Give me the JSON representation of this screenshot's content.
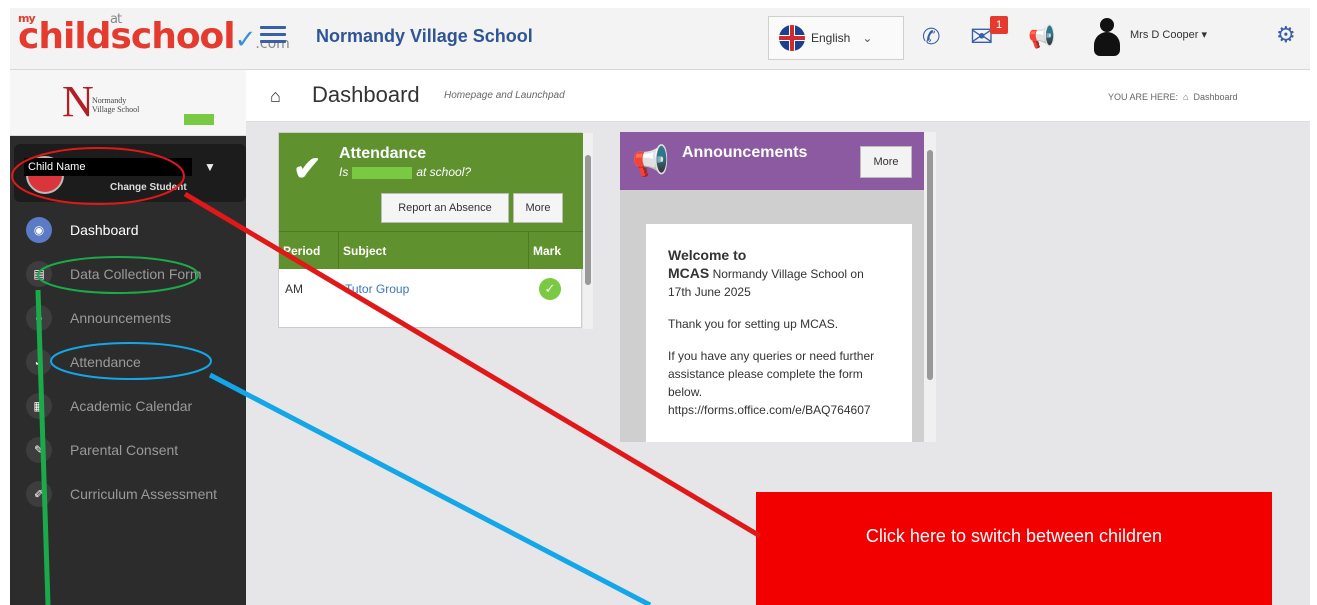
{
  "app": {
    "logo_my": "my",
    "logo_main": "ch",
    "logo_i": "i",
    "logo_ld": "ldschool",
    "logo_at": "at",
    "logo_com": ".com",
    "school_name": "Normandy Village School"
  },
  "topbar": {
    "language": "English",
    "mail_badge": "1",
    "user_name": "Mrs D Cooper",
    "user_chevron": "▾"
  },
  "school_logo": {
    "letter": "N",
    "line1": "Normandy",
    "line2": "Village School"
  },
  "child_switcher": {
    "name": "Child Name",
    "change_label": "Change Student"
  },
  "sidebar": {
    "items": [
      {
        "label": "Dashboard"
      },
      {
        "label": "Data Collection Form"
      },
      {
        "label": "Announcements"
      },
      {
        "label": "Attendance"
      },
      {
        "label": "Academic Calendar"
      },
      {
        "label": "Parental Consent"
      },
      {
        "label": "Curriculum Assessment"
      }
    ]
  },
  "header": {
    "title": "Dashboard",
    "subtitle": "Homepage and Launchpad",
    "breadcrumb_prefix": "YOU ARE HERE:",
    "breadcrumb_current": "Dashboard"
  },
  "attendance": {
    "title": "Attendance",
    "question_prefix": "Is",
    "question_suffix": "at school?",
    "report_button": "Report an Absence",
    "more_button": "More",
    "columns": [
      "Period",
      "Subject",
      "Mark"
    ],
    "rows": [
      {
        "period": "AM",
        "subject": "Tutor Group"
      }
    ]
  },
  "announcements": {
    "title": "Announcements",
    "more_button": "More",
    "welcome": "Welcome to",
    "mcas": "MCAS",
    "intro": "Normandy Village School on 17th June 2025",
    "thanks": "Thank you for setting up MCAS.",
    "queries": "If you have any queries or need further assistance please complete the form below.",
    "link": "https://forms.office.com/e/BAQ764607"
  },
  "callout": {
    "text": "Click here to switch between children"
  },
  "colors": {
    "attendance_green": "#60912f",
    "announcements_purple": "#8b5aa1",
    "callout_red": "#f20000",
    "annotation_red": "#e01818",
    "annotation_green": "#1aaa4a",
    "annotation_blue": "#13a6e8"
  }
}
